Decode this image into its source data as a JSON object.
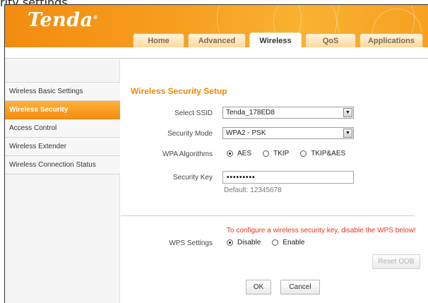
{
  "caption": "rity settings.",
  "brand": {
    "logo": "Tenda",
    "registered": "®"
  },
  "tabs": [
    {
      "label": "Home",
      "active": false
    },
    {
      "label": "Advanced",
      "active": false
    },
    {
      "label": "Wireless",
      "active": true
    },
    {
      "label": "QoS",
      "active": false
    },
    {
      "label": "Applications",
      "active": false
    }
  ],
  "sidebar": {
    "items": [
      {
        "label": "Wireless Basic Settings",
        "active": false
      },
      {
        "label": "Wireless Security",
        "active": true
      },
      {
        "label": "Access Control",
        "active": false
      },
      {
        "label": "Wireless Extender",
        "active": false
      },
      {
        "label": "Wireless Connection Status",
        "active": false
      }
    ]
  },
  "main": {
    "title": "Wireless Security Setup",
    "ssid": {
      "label": "Select SSID",
      "value": "Tenda_178ED8"
    },
    "mode": {
      "label": "Security Mode",
      "value": "WPA2 - PSK"
    },
    "algorithms": {
      "label": "WPA Algorithms",
      "options": [
        "AES",
        "TKIP",
        "TKIP&AES"
      ],
      "selected": "AES"
    },
    "key": {
      "label": "Security Key",
      "value": "•••••••••",
      "default_hint": "Default: 12345678"
    },
    "wps_warning": "To configure a wireless security key, disable the WPS below!",
    "wps": {
      "label": "WPS Settings",
      "options": [
        "Disable",
        "Enable"
      ],
      "selected": "Disable"
    },
    "reset_label": "Reset OOB",
    "ok_label": "OK",
    "cancel_label": "Cancel"
  },
  "colors": {
    "accent": "#f7a021",
    "title": "#f28a00",
    "warning": "#e8341c"
  }
}
